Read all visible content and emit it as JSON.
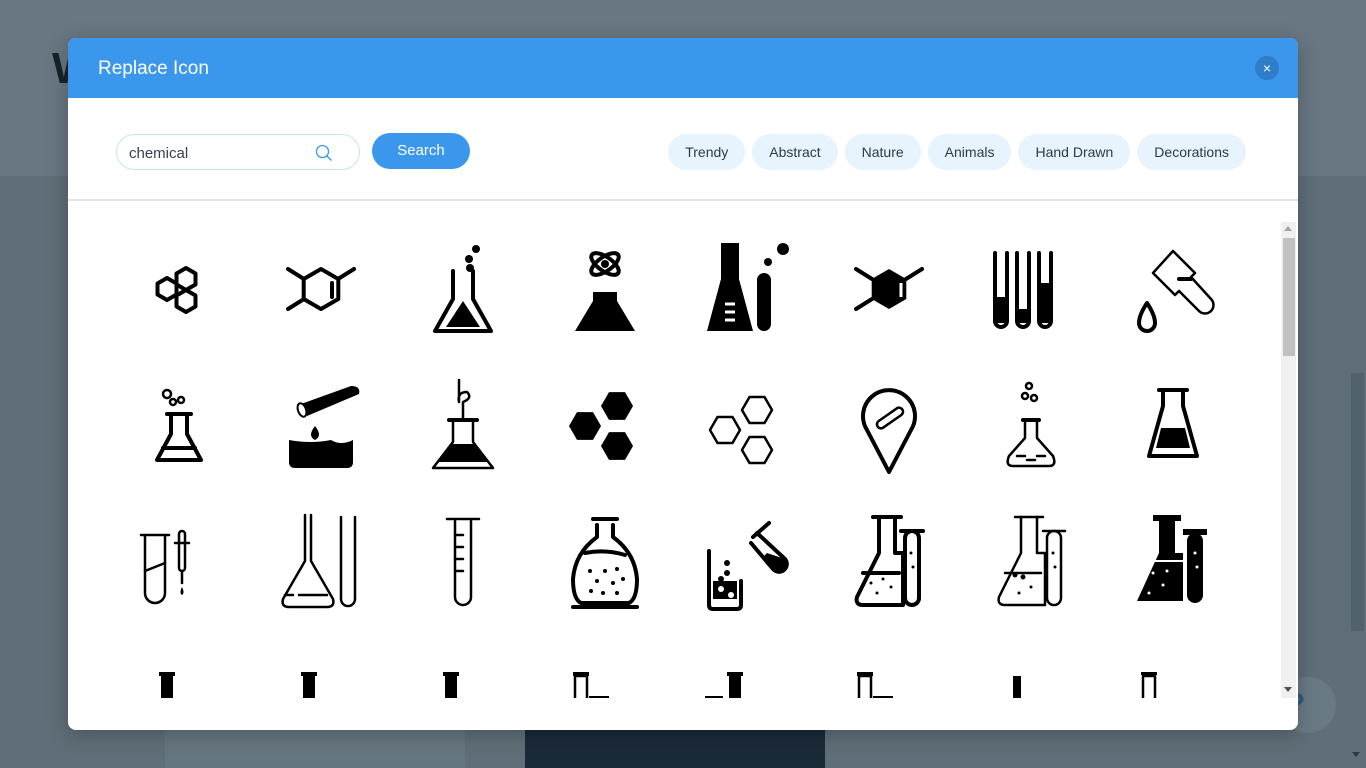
{
  "background": {
    "partial_heading_letter": "W",
    "help_label": "?"
  },
  "modal": {
    "title": "Replace Icon",
    "close_label": "×",
    "search": {
      "value": "chemical",
      "placeholder": "",
      "button_label": "Search"
    },
    "categories": [
      "Trendy",
      "Abstract",
      "Nature",
      "Animals",
      "Hand Drawn",
      "Decorations"
    ],
    "icons": [
      "graphene-molecule-icon",
      "cyclohexene-structure-icon",
      "flask-bubbles-icon",
      "atom-flask-icon",
      "flask-test-tube-icon",
      "hexagon-molecule-filled-icon",
      "test-tubes-rack-icon",
      "test-tube-drop-icon",
      "flask-bubbles-outline-icon",
      "pouring-test-tube-beaker-icon",
      "flask-coil-tube-icon",
      "hexagons-filled-icon",
      "hexagons-outline-icon",
      "location-pin-test-tube-icon",
      "flask-bubbles-thin-icon",
      "erlenmeyer-flask-icon",
      "test-tube-pipette-icon",
      "flask-tube-outline-icon",
      "graduated-test-tube-icon",
      "round-flask-dots-icon",
      "beaker-pouring-tube-icon",
      "flask-tube-dots-icon",
      "flask-tube-dots-thin-icon",
      "flask-tube-filled-icon",
      "lab-glass-set-1-icon",
      "lab-glass-set-2-icon",
      "lab-glass-set-3-icon",
      "lab-glass-set-4-icon",
      "lab-glass-set-5-icon",
      "lab-glass-set-6-icon",
      "lab-glass-set-7-icon",
      "lab-glass-set-8-icon"
    ]
  },
  "colors": {
    "header_blue": "#3b97ec",
    "close_button": "#2d7dc9",
    "chip_background": "#e7f4fd",
    "overlay": "#65747e"
  }
}
